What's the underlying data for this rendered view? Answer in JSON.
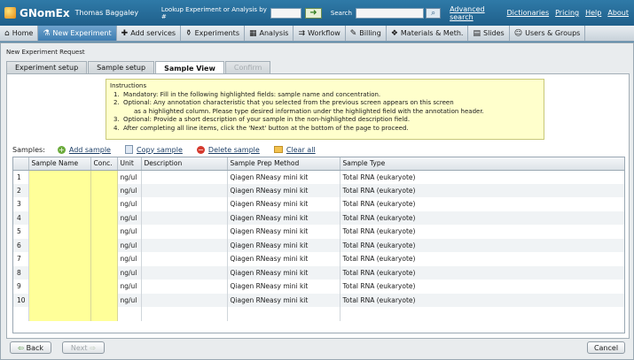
{
  "header": {
    "app_name": "GNomEx",
    "user_name": "Thomas Baggaley",
    "lookup_label": "Lookup Experiment or Analysis by #",
    "lookup_value": "",
    "search_label": "Search",
    "search_value": "",
    "advanced_search": "Advanced search",
    "links": [
      "Dictionaries",
      "Pricing",
      "Help",
      "About"
    ]
  },
  "nav": {
    "items": [
      {
        "label": "Home",
        "icon": "home-icon",
        "glyph": "⌂"
      },
      {
        "label": "New Experiment",
        "icon": "flask-icon",
        "glyph": "⚗"
      },
      {
        "label": "Add services",
        "icon": "services-icon",
        "glyph": "✚"
      },
      {
        "label": "Experiments",
        "icon": "beaker-icon",
        "glyph": "⚱"
      },
      {
        "label": "Analysis",
        "icon": "analysis-icon",
        "glyph": "▦"
      },
      {
        "label": "Workflow",
        "icon": "workflow-icon",
        "glyph": "⇉"
      },
      {
        "label": "Billing",
        "icon": "billing-icon",
        "glyph": "✎"
      },
      {
        "label": "Materials & Meth.",
        "icon": "materials-icon",
        "glyph": "❖"
      },
      {
        "label": "Slides",
        "icon": "slides-icon",
        "glyph": "▤"
      },
      {
        "label": "Users & Groups",
        "icon": "users-icon",
        "glyph": "☺"
      }
    ],
    "active_index": 1
  },
  "panel": {
    "title": "New Experiment Request",
    "tabs": [
      {
        "label": "Experiment setup",
        "state": "normal"
      },
      {
        "label": "Sample setup",
        "state": "normal"
      },
      {
        "label": "Sample View",
        "state": "active"
      },
      {
        "label": "Confirm",
        "state": "disabled"
      }
    ]
  },
  "instructions": {
    "title": "Instructions",
    "items": [
      {
        "num": "1.",
        "text": "Mandatory: Fill in the following highlighted fields:  sample name and concentration."
      },
      {
        "num": "2.",
        "text": "Optional: Any annotation characteristic that you selected from the previous screen appears on this screen",
        "cont": "as a highlighted column. Please type desired information under the highlighted field with the annotation header."
      },
      {
        "num": "3.",
        "text": "Optional: Provide a short description of your sample in the non-highlighted description field."
      },
      {
        "num": "4.",
        "text": "After completing all line items, click the 'Next' button at the bottom of the page to proceed."
      }
    ]
  },
  "samples_toolbar": {
    "label": "Samples:",
    "add": "Add sample",
    "copy": "Copy sample",
    "delete": "Delete sample",
    "clear": "Clear all"
  },
  "grid": {
    "columns": [
      "",
      "Sample Name",
      "Conc.",
      "Unit",
      "Description",
      "Sample Prep Method",
      "Sample Type"
    ],
    "rows": [
      [
        "1",
        "",
        "",
        "ng/ul",
        "",
        "Qiagen RNeasy mini kit",
        "Total RNA (eukaryote)"
      ],
      [
        "2",
        "",
        "",
        "ng/ul",
        "",
        "Qiagen RNeasy mini kit",
        "Total RNA (eukaryote)"
      ],
      [
        "3",
        "",
        "",
        "ng/ul",
        "",
        "Qiagen RNeasy mini kit",
        "Total RNA (eukaryote)"
      ],
      [
        "4",
        "",
        "",
        "ng/ul",
        "",
        "Qiagen RNeasy mini kit",
        "Total RNA (eukaryote)"
      ],
      [
        "5",
        "",
        "",
        "ng/ul",
        "",
        "Qiagen RNeasy mini kit",
        "Total RNA (eukaryote)"
      ],
      [
        "6",
        "",
        "",
        "ng/ul",
        "",
        "Qiagen RNeasy mini kit",
        "Total RNA (eukaryote)"
      ],
      [
        "7",
        "",
        "",
        "ng/ul",
        "",
        "Qiagen RNeasy mini kit",
        "Total RNA (eukaryote)"
      ],
      [
        "8",
        "",
        "",
        "ng/ul",
        "",
        "Qiagen RNeasy mini kit",
        "Total RNA (eukaryote)"
      ],
      [
        "9",
        "",
        "",
        "ng/ul",
        "",
        "Qiagen RNeasy mini kit",
        "Total RNA (eukaryote)"
      ],
      [
        "10",
        "",
        "",
        "ng/ul",
        "",
        "Qiagen RNeasy mini kit",
        "Total RNA (eukaryote)"
      ]
    ],
    "highlight_color": "#ffff99"
  },
  "footer": {
    "back": "Back",
    "next": "Next",
    "cancel": "Cancel"
  }
}
